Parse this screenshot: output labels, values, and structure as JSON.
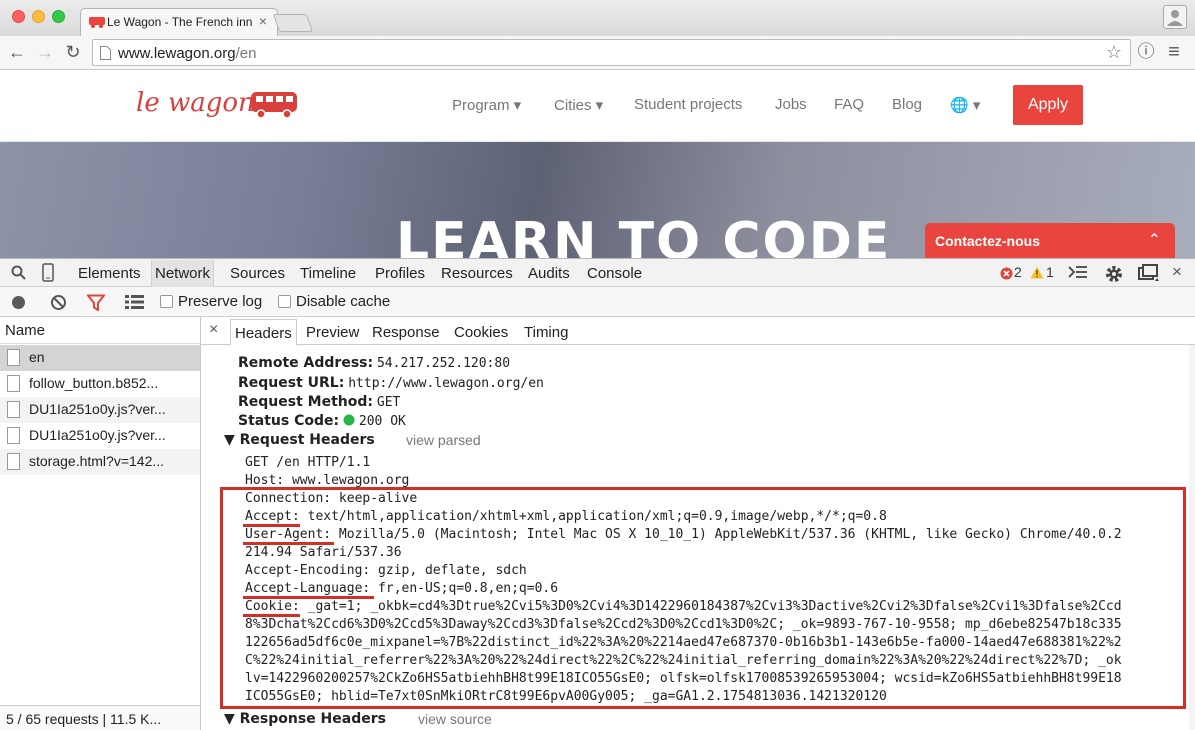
{
  "browser": {
    "tab_title": "Le Wagon - The French inn",
    "tab_close": "×",
    "url_host": "www.lewagon.org",
    "url_path": "/en",
    "back": "←",
    "forward": "→",
    "reload": "↻",
    "star": "☆",
    "menu": "≡",
    "info": "ⓘ"
  },
  "site": {
    "logo": "le wagon",
    "nav": {
      "program": "Program ▾",
      "cities": "Cities ▾",
      "student_projects": "Student projects",
      "jobs": "Jobs",
      "faq": "FAQ",
      "blog": "Blog",
      "language": "🌐 ▾"
    },
    "apply": "Apply",
    "hero_title": "LEARN TO CODE",
    "contact": "Contactez-nous",
    "contact_chevron": "⌃"
  },
  "devtools": {
    "tabs": {
      "elements": "Elements",
      "network": "Network",
      "sources": "Sources",
      "timeline": "Timeline",
      "profiles": "Profiles",
      "resources": "Resources",
      "audits": "Audits",
      "console": "Console"
    },
    "errors": "2",
    "warnings": "1",
    "close": "×",
    "filter": {
      "preserve_log": "Preserve log",
      "disable_cache": "Disable cache"
    },
    "requests": {
      "header": "Name",
      "items": [
        "en",
        "follow_button.b852...",
        "DU1Ia251o0y.js?ver...",
        "DU1Ia251o0y.js?ver...",
        "storage.html?v=142..."
      ],
      "summary": "5 / 65 requests | 11.5 K..."
    },
    "detail": {
      "close": "×",
      "tabs": {
        "headers": "Headers",
        "preview": "Preview",
        "response": "Response",
        "cookies": "Cookies",
        "timing": "Timing"
      },
      "general": {
        "remote_address_key": "Remote Address:",
        "remote_address": "54.217.252.120:80",
        "request_url_key": "Request URL:",
        "request_url": "http://www.lewagon.org/en",
        "request_method_key": "Request Method:",
        "request_method": "GET",
        "status_code_key": "Status Code:",
        "status_code": "200 OK"
      },
      "request_headers_title": "▼ Request Headers",
      "view_parsed": "view parsed",
      "request_lines": {
        "l1": "GET /en HTTP/1.1",
        "l2": "Host: www.lewagon.org",
        "l3": "Connection: keep-alive",
        "l4": "Accept: text/html,application/xhtml+xml,application/xml;q=0.9,image/webp,*/*;q=0.8",
        "l5": "User-Agent: Mozilla/5.0 (Macintosh; Intel Mac OS X 10_10_1) AppleWebKit/537.36 (KHTML, like Gecko) Chrome/40.0.2",
        "l6": "214.94 Safari/537.36",
        "l7": "Accept-Encoding: gzip, deflate, sdch",
        "l8": "Accept-Language: fr,en-US;q=0.8,en;q=0.6",
        "l9": "Cookie: _gat=1; _okbk=cd4%3Dtrue%2Cvi5%3D0%2Cvi4%3D1422960184387%2Cvi3%3Dactive%2Cvi2%3Dfalse%2Cvi1%3Dfalse%2Ccd",
        "l10": "8%3Dchat%2Ccd6%3D0%2Ccd5%3Daway%2Ccd3%3Dfalse%2Ccd2%3D0%2Ccd1%3D0%2C; _ok=9893-767-10-9558; mp_d6ebe82547b18c335",
        "l11": "122656ad5df6c0e_mixpanel=%7B%22distinct_id%22%3A%20%2214aed47e687370-0b16b3b1-143e6b5e-fa000-14aed47e688381%22%2",
        "l12": "C%22%24initial_referrer%22%3A%20%22%24direct%22%2C%22%24initial_referring_domain%22%3A%20%22%24direct%22%7D; _ok",
        "l13": "lv=1422960200257%2CkZo6HS5atbiehhBH8t99E18ICO55GsE0; olfsk=olfsk17008539265953004; wcsid=kZo6HS5atbiehhBH8t99E18",
        "l14": "ICO55GsE0; hblid=Te7xt0SnMkiORtrC8t99E6pvA00Gy005; _ga=GA1.2.1754813036.1421320120"
      },
      "response_headers_title": "▼ Response Headers",
      "view_source": "view source"
    }
  },
  "colors": {
    "accent": "#e9453e",
    "highlight": "#d32f27"
  }
}
